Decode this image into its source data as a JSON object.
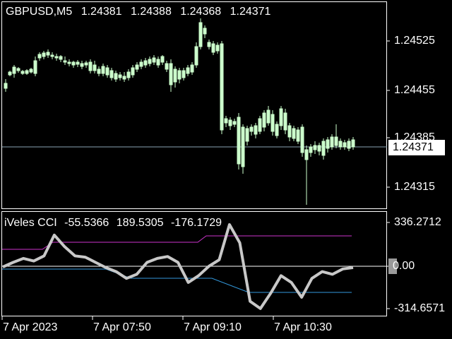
{
  "chart_title": {
    "symbol_timeframe": "GBPUSD,M5",
    "open": "1.24381",
    "high": "1.24388",
    "low": "1.24368",
    "close": "1.24371"
  },
  "price_axis": {
    "labels": [
      "1.24525",
      "1.24455",
      "1.24385",
      "1.24315"
    ],
    "current_price": "1.24371"
  },
  "indicator": {
    "name": "iVeles CCI",
    "values": [
      "-55.5366",
      "189.5305",
      "-176.1729"
    ],
    "axis_labels": {
      "top": "336.2712",
      "zero": "0.00",
      "bottom": "-314.6571"
    }
  },
  "time_axis": [
    "7 Apr 2023",
    "7 Apr 07:50",
    "7 Apr 09:10",
    "7 Apr 10:30"
  ],
  "colors": {
    "background": "#000000",
    "grid_border": "#ffffff",
    "candle_up": "#ccffcc",
    "candle_down": "#000000",
    "bid_line": "#8aa4b4",
    "cci_line": "#c8c8c8",
    "upper_band": "#cc33cc",
    "lower_band": "#3399dd"
  },
  "chart_data": {
    "type": "line",
    "x_labels": [
      "7 Apr 2023",
      "7 Apr 07:50",
      "7 Apr 09:10",
      "7 Apr 10:30"
    ],
    "series": [
      {
        "name": "iVeles CCI",
        "values": [
          -5,
          30,
          60,
          40,
          80,
          240,
          150,
          80,
          70,
          30,
          -10,
          -40,
          -90,
          -60,
          30,
          60,
          75,
          30,
          -120,
          -70,
          0,
          50,
          320,
          180,
          -260,
          -314,
          -200,
          -70,
          -120,
          -230,
          -90,
          -40,
          -60,
          -20,
          -10
        ]
      }
    ]
  }
}
